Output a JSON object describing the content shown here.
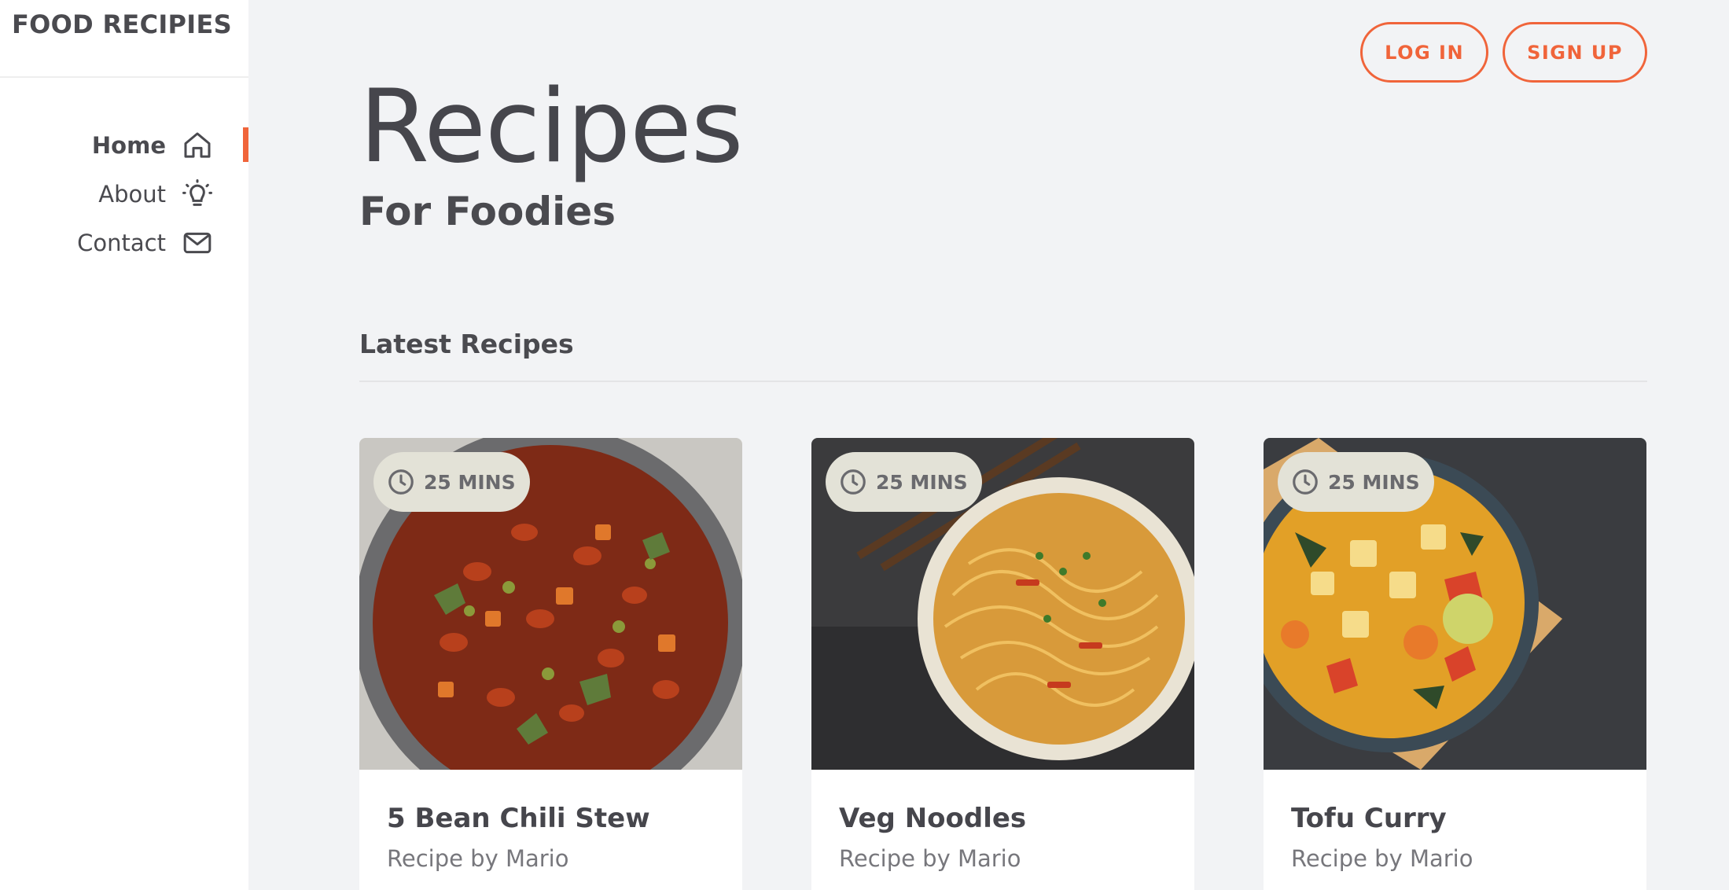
{
  "brand": {
    "title": "FOOD RECIPIES"
  },
  "nav": {
    "items": [
      {
        "label": "Home",
        "icon": "home-icon",
        "active": true
      },
      {
        "label": "About",
        "icon": "lightbulb-icon",
        "active": false
      },
      {
        "label": "Contact",
        "icon": "mail-icon",
        "active": false
      }
    ]
  },
  "header": {
    "login_label": "LOG IN",
    "signup_label": "SIGN UP"
  },
  "hero": {
    "title": "Recipes",
    "subtitle": "For Foodies"
  },
  "section": {
    "title": "Latest Recipes"
  },
  "recipes": [
    {
      "title": "5 Bean Chili Stew",
      "author": "Recipe by Mario",
      "time": "25 MINS",
      "image": "bean-chili-stew-photo"
    },
    {
      "title": "Veg Noodles",
      "author": "Recipe by Mario",
      "time": "25 MINS",
      "image": "veg-noodles-photo"
    },
    {
      "title": "Tofu Curry",
      "author": "Recipe by Mario",
      "time": "25 MINS",
      "image": "tofu-curry-photo"
    }
  ],
  "colors": {
    "accent": "#f0643a",
    "background": "#f2f3f5",
    "text": "#4a4a4f",
    "badge": "#e3e2d7"
  }
}
